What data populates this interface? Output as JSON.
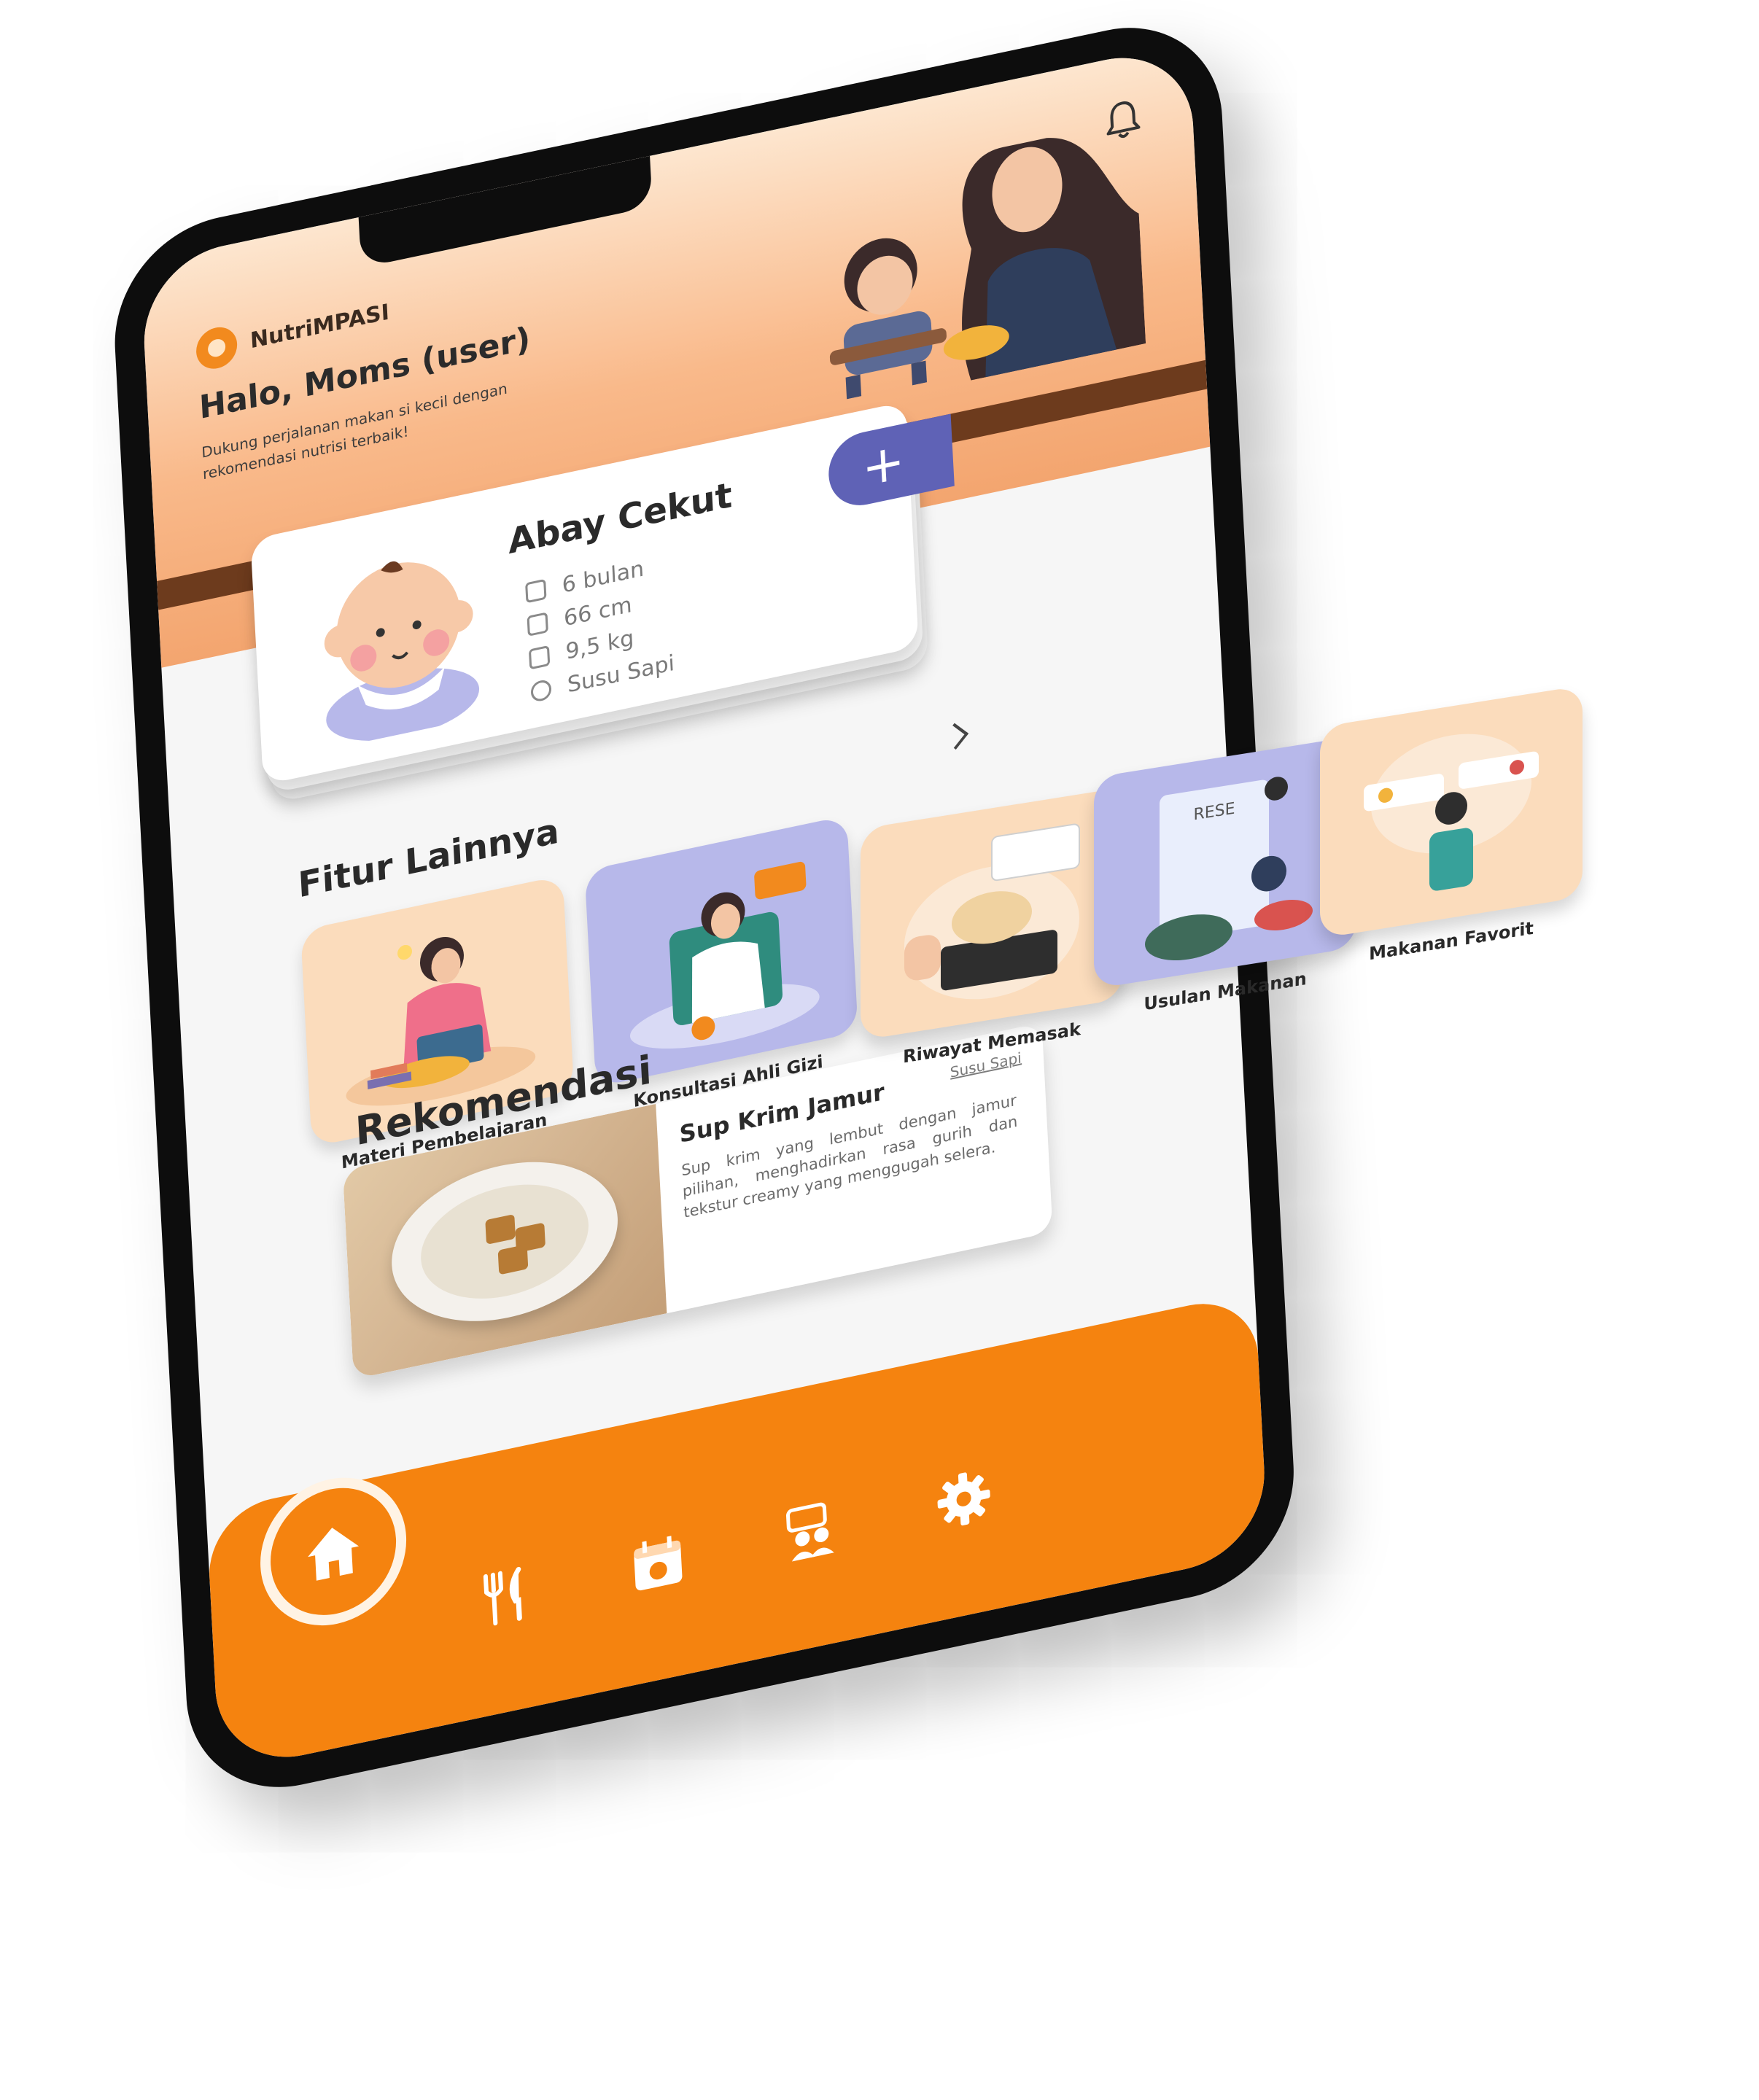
{
  "app": {
    "brand": "NutriMPASI",
    "greeting": "Halo, Moms (user)",
    "tagline": "Dukung perjalanan makan si kecil dengan rekomendasi nutrisi terbaik!"
  },
  "child": {
    "name": "Abay Cekut",
    "age": "6 bulan",
    "height": "66 cm",
    "weight": "9,5 kg",
    "milk": "Susu Sapi",
    "add_label": "+"
  },
  "features": {
    "title": "Fitur Lainnya",
    "items": [
      {
        "label": "Materi Pembelajaran"
      },
      {
        "label": "Konsultasi Ahli Gizi"
      },
      {
        "label": "Riwayat Memasak"
      },
      {
        "label": "Usulan Makanan"
      },
      {
        "label": "Makanan Favorit"
      }
    ]
  },
  "recommendation": {
    "title": "Rekomendasi",
    "item": {
      "name": "Sup Krim Jamur",
      "description": "Sup krim yang lembut dengan jamur pilihan, menghadirkan rasa gurih dan tekstur creamy yang menggugah selera.",
      "tag": "Susu Sapi"
    }
  },
  "nav": {
    "items": [
      "home-icon",
      "utensils-icon",
      "calendar-chef-icon",
      "community-chat-icon",
      "gear-icon"
    ],
    "active": "home-icon"
  },
  "colors": {
    "accent": "#f5830f",
    "lavender": "#b7b8ea",
    "peach": "#fbdcbc",
    "button": "#5f62b6"
  }
}
